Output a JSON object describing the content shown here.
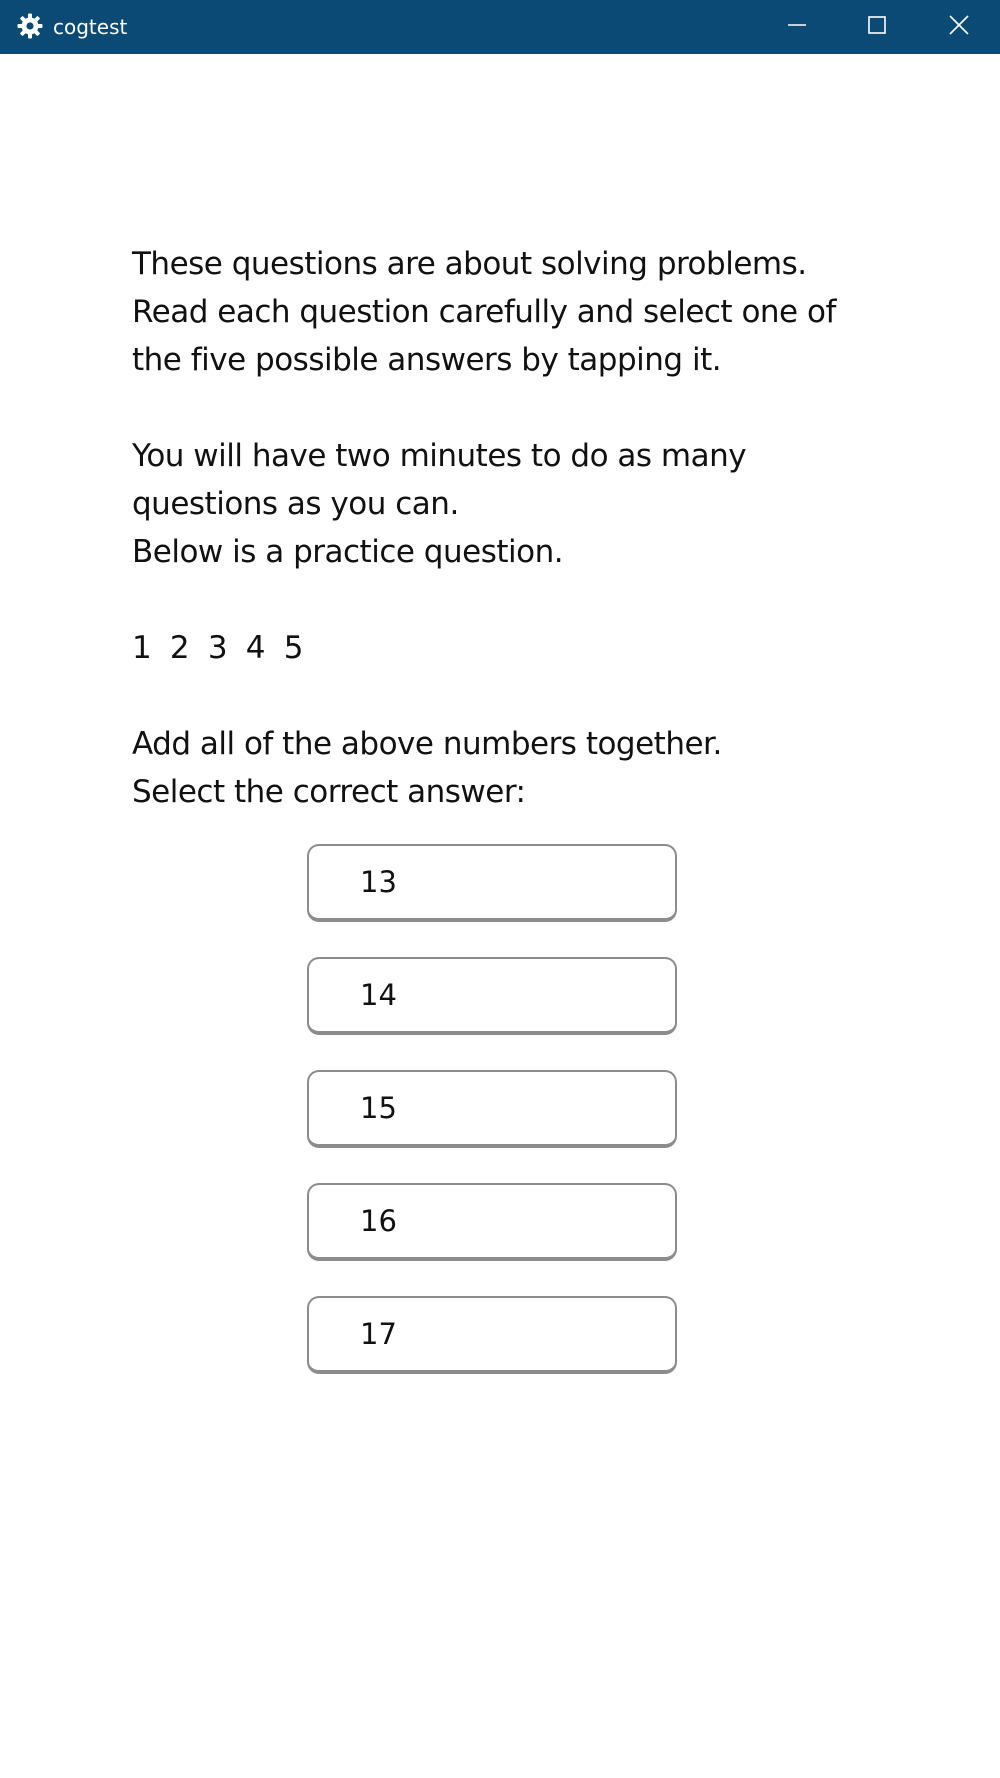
{
  "window": {
    "title": "cogtest",
    "icon": "gear-icon",
    "titlebar_color": "#0b4a74",
    "controls": [
      "minimize-icon",
      "maximize-icon",
      "close-icon"
    ]
  },
  "instructions": {
    "line1": "These questions are about solving problems.",
    "line2": "Read each question carefully and select one of",
    "line3": "the five possible answers by tapping it.",
    "line4": "You will have two minutes to do as many",
    "line5": "questions as you can.",
    "line6": "Below is a practice question."
  },
  "question": {
    "numbers": "1  2  3  4  5",
    "prompt": "Add all of the above numbers together.",
    "instruction": "Select the correct answer:"
  },
  "answers": [
    {
      "label": "13"
    },
    {
      "label": "14"
    },
    {
      "label": "15"
    },
    {
      "label": "16"
    },
    {
      "label": "17"
    }
  ]
}
